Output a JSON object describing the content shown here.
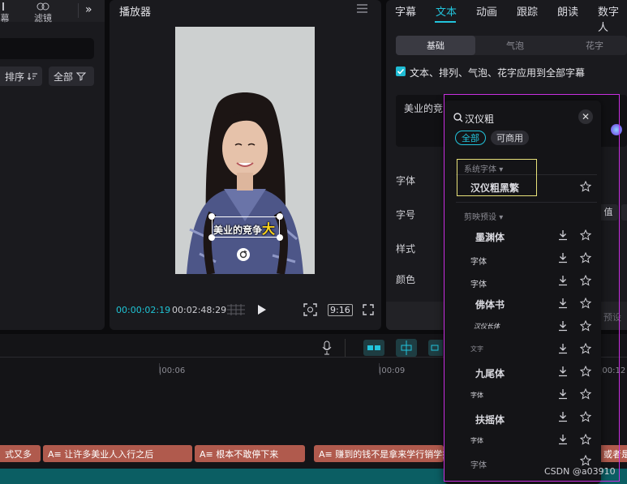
{
  "left_panel": {
    "tabs": [
      {
        "label": "幕"
      },
      {
        "label": "滤镜"
      }
    ],
    "sort_label": "排序",
    "filter_label": "全部"
  },
  "player": {
    "title": "播放器",
    "caption_main": "美业的竞争",
    "caption_accent": "大",
    "current_time": "00:00:02:19",
    "total_time": "00:02:48:29",
    "ratio": "9:16"
  },
  "right_panel": {
    "tabs": [
      {
        "label": "字幕"
      },
      {
        "label": "文本"
      },
      {
        "label": "动画"
      },
      {
        "label": "跟踪"
      },
      {
        "label": "朗读"
      },
      {
        "label": "数字人"
      }
    ],
    "subtabs": [
      {
        "label": "基础"
      },
      {
        "label": "气泡"
      },
      {
        "label": "花字"
      }
    ],
    "apply_all_label": "文本、排列、气泡、花字应用到全部字幕",
    "text_value": "美业的竞",
    "properties": [
      {
        "label": "字体"
      },
      {
        "label": "字号"
      },
      {
        "label": "样式"
      },
      {
        "label": "颜色"
      }
    ],
    "value_stub": "值",
    "preset_stub": "预设"
  },
  "timeline": {
    "ruler": [
      "|00:06",
      "|00:09",
      "|00:12"
    ],
    "clips": [
      {
        "text": "式又多"
      },
      {
        "text": "A≡ 让许多美业人入行之后"
      },
      {
        "text": "A≡ 根本不敢停下来"
      },
      {
        "text": "A≡ 赚到的钱不是拿来学行销学技术"
      },
      {
        "text": "或者是"
      }
    ]
  },
  "font_dropdown": {
    "search_value": "汉仪粗",
    "chips": [
      {
        "label": "全部"
      },
      {
        "label": "可商用"
      }
    ],
    "section_system": "系统字体",
    "system_font": "汉仪粗黑繁",
    "section_preset": "剪映预设",
    "preset_fonts": [
      {
        "label": "墨渊体"
      },
      {
        "label": "字体"
      },
      {
        "label": "字体"
      },
      {
        "label": "佛体书"
      },
      {
        "label": "汉仪长体"
      },
      {
        "label": "文字"
      },
      {
        "label": "九尾体"
      },
      {
        "label": "字体"
      },
      {
        "label": "扶摇体"
      },
      {
        "label": "字体"
      },
      {
        "label": "字体"
      }
    ]
  },
  "watermark": "CSDN @a03910",
  "colors": {
    "accent": "#22c4dc",
    "highlight_box": "#e8e27a",
    "outline": "#c82fe0",
    "clip": "#b05a4d"
  }
}
